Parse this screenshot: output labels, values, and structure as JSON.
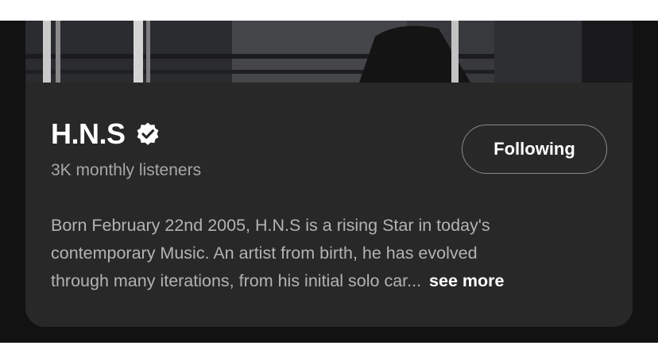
{
  "artist": {
    "name": "H.N.S",
    "verified_icon": "verified-badge-icon",
    "monthly_listeners": "3K monthly listeners"
  },
  "follow_button": {
    "label": "Following"
  },
  "bio": {
    "line1": "Born February 22nd 2005, H.N.S is a rising Star in today's",
    "line2": "contemporary Music. An artist from birth, he has evolved",
    "line3": "through many iterations, from his initial solo car...",
    "see_more_label": "see more"
  },
  "colors": {
    "card_background": "#282828",
    "page_background": "#121212",
    "primary_text": "#ffffff",
    "secondary_text": "#a7a7a7"
  }
}
